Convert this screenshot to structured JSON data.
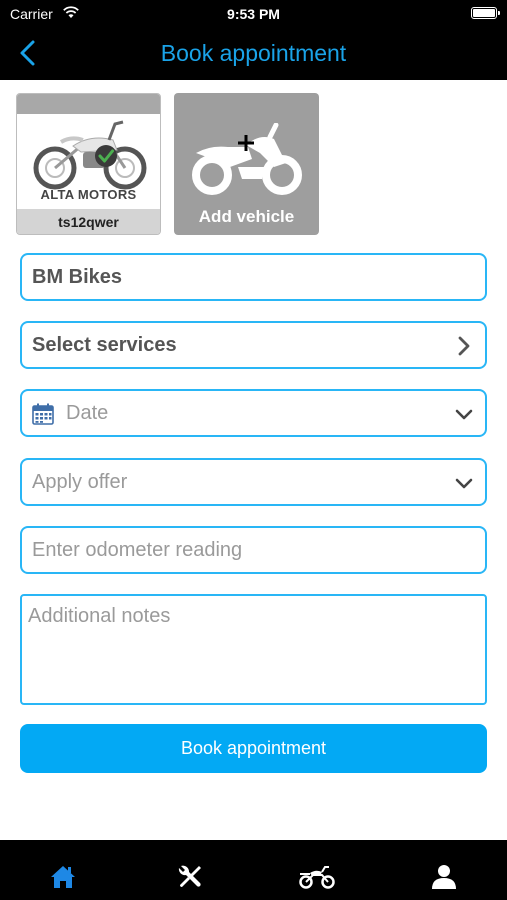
{
  "status_bar": {
    "carrier": "Carrier",
    "time": "9:53 PM"
  },
  "nav": {
    "title": "Book appointment"
  },
  "vehicles": [
    {
      "brand": "ALTA MOTORS",
      "plate": "ts12qwer"
    }
  ],
  "add_vehicle": {
    "label": "Add vehicle"
  },
  "form": {
    "garage": "BM Bikes",
    "services": "Select services",
    "date_placeholder": "Date",
    "offer_placeholder": "Apply offer",
    "odometer_placeholder": "Enter odometer reading",
    "notes_placeholder": "Additional notes"
  },
  "book_button": {
    "label": "Book appointment"
  },
  "tab_bar": {
    "active_tab": "home",
    "icons": [
      "home-icon",
      "tools-icon",
      "motorcycle-icon",
      "profile-icon"
    ]
  },
  "colors": {
    "accent": "#1aa3e8",
    "button": "#03a9f4",
    "field_border": "#29b6f6",
    "active_tab": "#1e88e5"
  }
}
